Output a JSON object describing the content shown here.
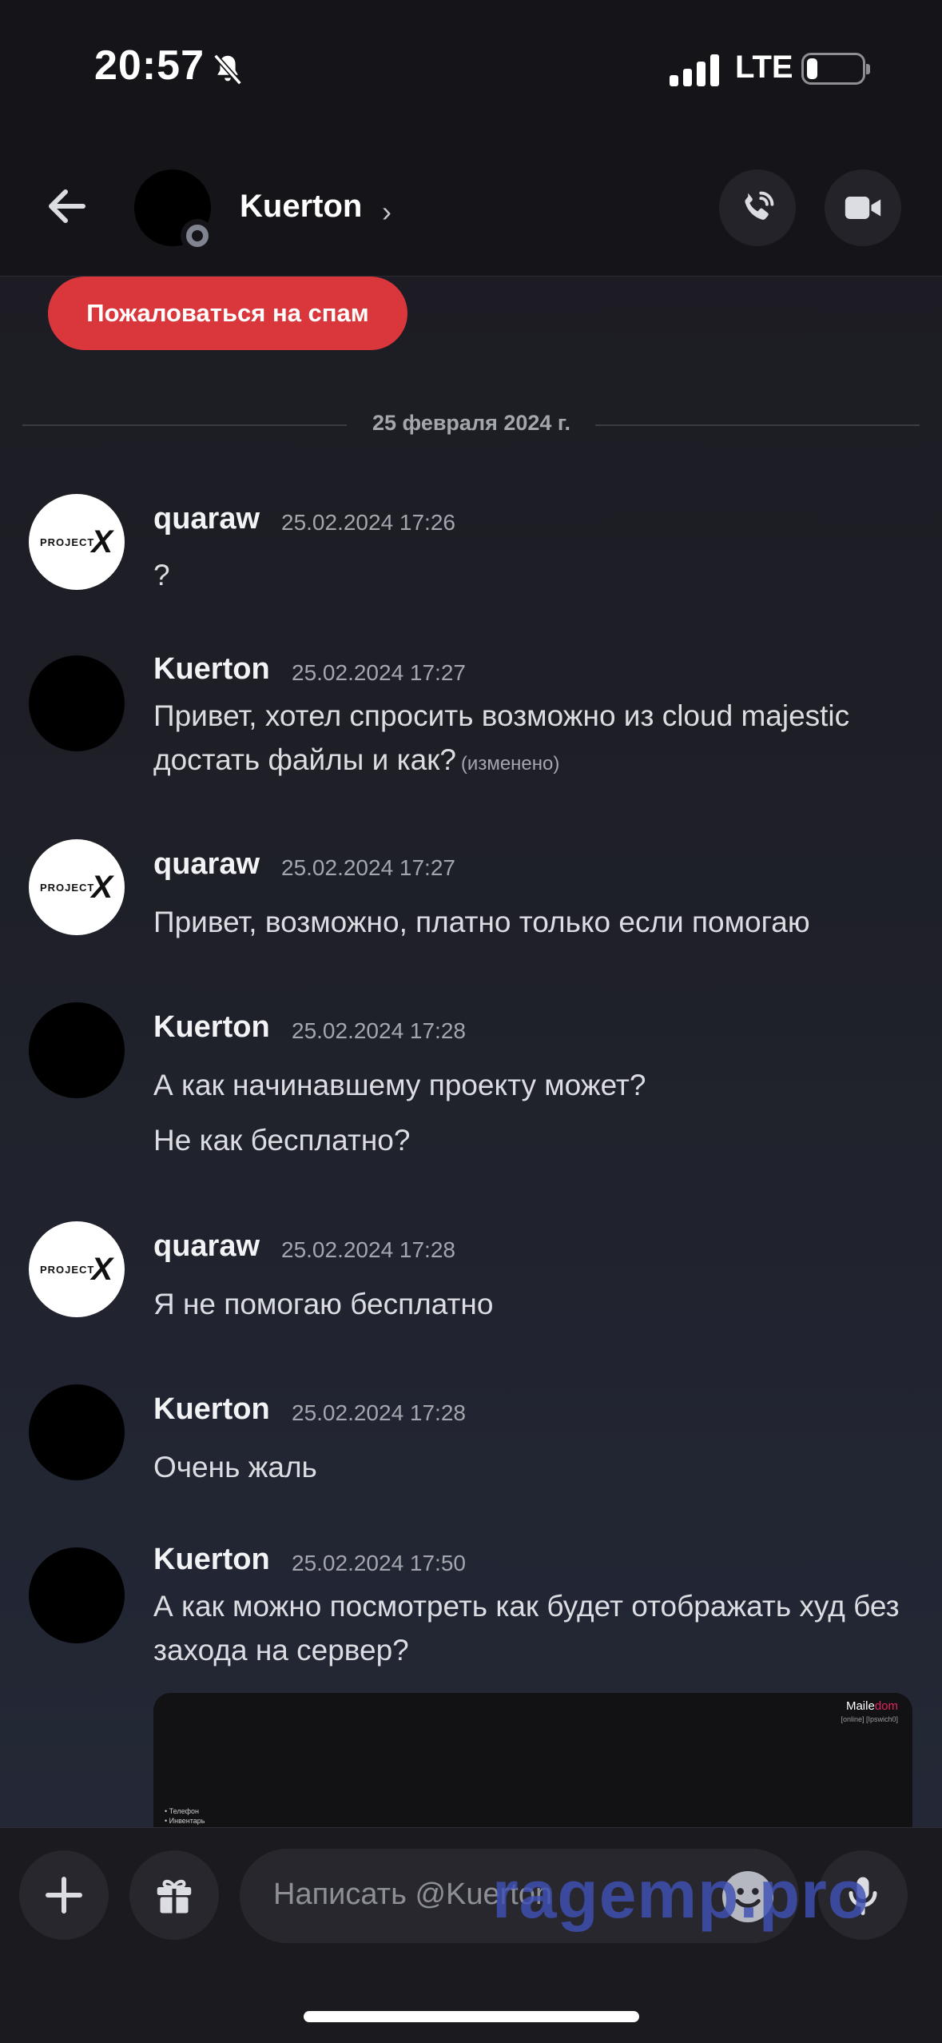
{
  "status_bar": {
    "time": "20:57",
    "network": "LTE",
    "battery_level": 0.2,
    "icons": [
      "bell-slash-icon",
      "signal-icon",
      "battery-icon"
    ]
  },
  "header": {
    "contact_name": "Kuerton",
    "chevron": "›",
    "icons": [
      "back-arrow-icon",
      "phone-icon",
      "video-camera-icon"
    ]
  },
  "spam_button": {
    "label": "Пожаловаться на спам"
  },
  "date_divider": "25 февраля 2024 г.",
  "messages": [
    {
      "author": "quaraw",
      "time": "25.02.2024 17:26",
      "lines": [
        "?"
      ],
      "avatar": "projectx"
    },
    {
      "author": "Kuerton",
      "time": "25.02.2024 17:27",
      "lines": [
        "Привет, хотел спросить возможно из cloud majestic достать файлы и как?"
      ],
      "edited": "(изменено)",
      "avatar": "black"
    },
    {
      "author": "quaraw",
      "time": "25.02.2024 17:27",
      "lines": [
        "Привет, возможно, платно только если помогаю"
      ],
      "avatar": "projectx"
    },
    {
      "author": "Kuerton",
      "time": "25.02.2024 17:28",
      "lines": [
        "А как начинавшему проекту может?",
        "Не как бесплатно?"
      ],
      "avatar": "black"
    },
    {
      "author": "quaraw",
      "time": "25.02.2024 17:28",
      "lines": [
        "Я не помогаю бесплатно"
      ],
      "avatar": "projectx"
    },
    {
      "author": "Kuerton",
      "time": "25.02.2024 17:28",
      "lines": [
        "Очень жаль"
      ],
      "avatar": "black"
    },
    {
      "author": "Kuerton",
      "time": "25.02.2024 17:50",
      "lines": [
        "А как можно посмотреть как будет отображать худ без захода на сервер?"
      ],
      "avatar": "black"
    }
  ],
  "avatar_logo": {
    "text": "PROJECT",
    "mark": "X"
  },
  "attachment": {
    "brand_prefix": "Maile",
    "brand_suffix": "dom",
    "subtitle": "[online] [Ipswich0]",
    "menu": [
      "Телефон",
      "Инвентарь"
    ]
  },
  "composer": {
    "placeholder": "Написать @Kuerton",
    "icons": [
      "plus-icon",
      "gift-icon",
      "emoji-icon",
      "microphone-icon"
    ]
  },
  "watermark": "ragemp.pro",
  "colors": {
    "spam_red": "#da373c",
    "background": "#1e1f27",
    "header_bg": "#151419",
    "watermark": "#3f51b5"
  }
}
